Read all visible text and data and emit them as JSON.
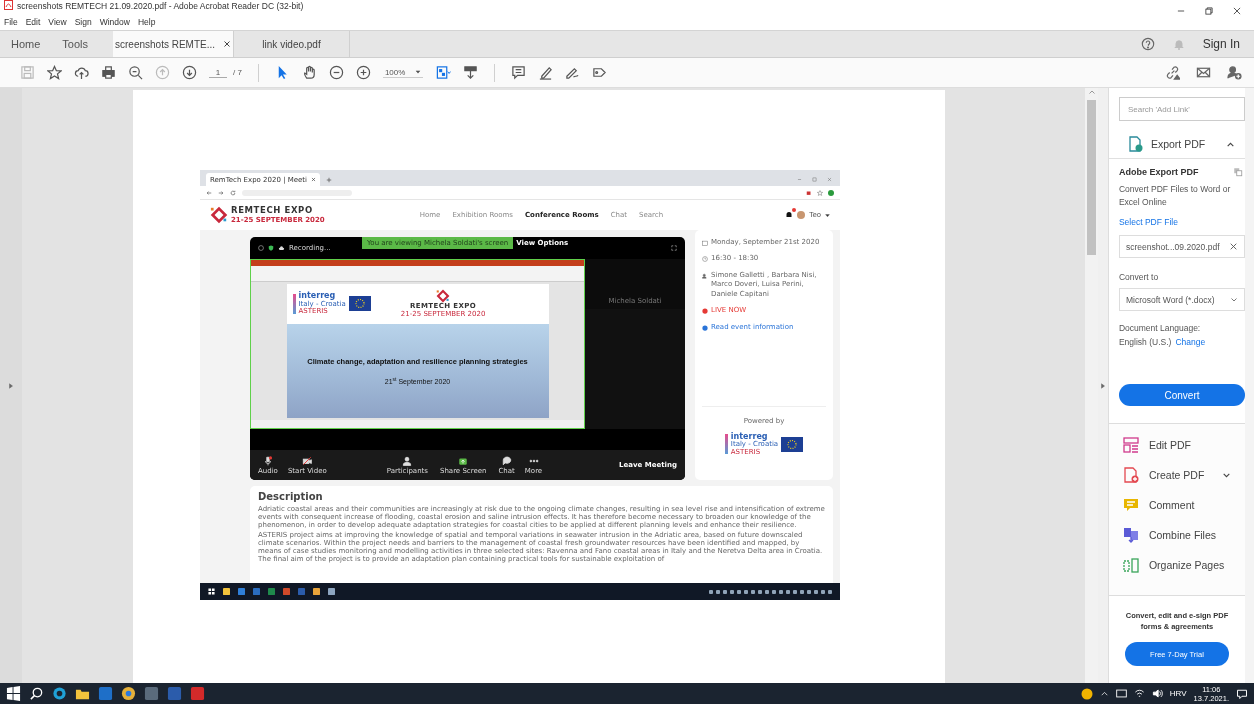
{
  "window": {
    "title": "screenshots REMTECH 21.09.2020.pdf - Adobe Acrobat Reader DC (32-bit)"
  },
  "menu": [
    "File",
    "Edit",
    "View",
    "Sign",
    "Window",
    "Help"
  ],
  "nav_tabs": [
    {
      "label": "Home",
      "selected": false
    },
    {
      "label": "Tools",
      "selected": false
    }
  ],
  "doc_tabs": [
    {
      "label": "screenshots REMTE...",
      "selected": true
    },
    {
      "label": "link video.pdf",
      "selected": false
    }
  ],
  "sign_in": "Sign In",
  "toolbar": {
    "nav_tools": [
      {
        "kind": "save",
        "disabled": true
      },
      {
        "kind": "star",
        "disabled": false
      },
      {
        "kind": "upload",
        "disabled": false
      },
      {
        "kind": "print",
        "disabled": false
      },
      {
        "kind": "find",
        "disabled": false
      },
      {
        "kind": "prev",
        "disabled": true
      },
      {
        "kind": "next",
        "disabled": false
      }
    ],
    "page": "1",
    "page_count": "/ 7",
    "view_tools": [
      {
        "kind": "select",
        "active": true
      },
      {
        "kind": "hand",
        "active": false
      },
      {
        "kind": "zoomout",
        "active": false
      },
      {
        "kind": "zoomin",
        "active": false
      }
    ],
    "zoom": "100%",
    "edit_tools": [
      {
        "kind": "comment"
      },
      {
        "kind": "highlight"
      },
      {
        "kind": "sign"
      },
      {
        "kind": "tag"
      }
    ]
  },
  "document": {
    "browser_tab": "RemTech Expo 2020 | Meeti",
    "site": {
      "logo_title": "REMTECH EXPO",
      "logo_dates": "21-25 SEPTEMBER 2020",
      "nav": [
        {
          "label": "Home",
          "selected": false
        },
        {
          "label": "Exhibition Rooms",
          "selected": false
        },
        {
          "label": "Conference Rooms",
          "selected": true
        },
        {
          "label": "Chat",
          "selected": false
        },
        {
          "label": "Search",
          "selected": false
        }
      ],
      "user": "Teo"
    },
    "meeting": {
      "recording": "Recording...",
      "banner": "You are viewing Michela Soldati's screen",
      "view_options": "View Options",
      "participant": "Michela Soldati",
      "controls": [
        {
          "label": "Audio",
          "kind": "audio"
        },
        {
          "label": "Start Video",
          "kind": "video"
        },
        {
          "label": "Participants",
          "kind": "participants"
        },
        {
          "label": "Share Screen",
          "kind": "share"
        },
        {
          "label": "Chat",
          "kind": "chat"
        },
        {
          "label": "More",
          "kind": "more"
        }
      ],
      "leave": "Leave Meeting"
    },
    "slide": {
      "partner": "interreg",
      "partner_sub": "Italy - Croatia",
      "project": "ASTERIS",
      "logo_title": "REMTECH EXPO",
      "logo_dates": "21-25 SEPTEMBER 2020",
      "title": "Climate change, adaptation and resilience planning strategies",
      "date": "21$^{st}$ September 2020"
    },
    "event": {
      "date": "Monday, September 21st 2020",
      "time": "16:30 - 18:30",
      "speakers": "Simone Galletti , Barbara Nisi, Marco Doveri, Luisa Perini, Daniele Capitani",
      "live": "LIVE NOW",
      "read_more": "Read event information",
      "powered_by": "Powered by",
      "partner": "interreg",
      "partner_sub": "Italy - Croatia",
      "project": "ASTERIS"
    },
    "description": {
      "heading": "Description",
      "paragraphs": [
        "Adriatic coastal areas and their communities are increasingly at risk due to the ongoing climate changes, resulting in sea level rise and intensification of extreme events with consequent increase of flooding, coastal erosion and saline intrusion effects. It has therefore become necessary to broaden our knowledge of the phenomenon, in order to develop adequate adaptation strategies for coastal cities to be applied at different planning levels and enhance their resilience.",
        "ASTERIS project aims at improving the knowledge of spatial and temporal variations in seawater intrusion in the Adriatic area, based on future downscaled climate scenarios. Within the project needs and barriers to the management of coastal fresh groundwater resources have been identified and mapped, by means of case studies monitoring and modelling activities in three selected sites: Ravenna and Fano coastal areas in Italy and the Neretva Delta area in Croatia. The final aim of the project is to provide an adaptation plan containing practical tools for sustainable exploitation of"
      ]
    }
  },
  "side_panel": {
    "search": {
      "placeholder": "Search 'Add Link'"
    },
    "export": {
      "label": "Export PDF",
      "expanded": true,
      "heading": "Adobe Export PDF",
      "text": "Convert PDF Files to Word or Excel Online",
      "select_link": "Select PDF File",
      "file": "screenshot...09.2020.pdf",
      "convert_label": "Convert to",
      "format": "Microsoft Word (*.docx)",
      "language_label": "Document Language:",
      "language": "English (U.S.)",
      "change": "Change",
      "button": "Convert"
    },
    "tools": [
      {
        "label": "Edit PDF",
        "kind": "edit",
        "expandable": false
      },
      {
        "label": "Create PDF",
        "kind": "create",
        "expandable": true
      },
      {
        "label": "Comment",
        "kind": "comment",
        "expandable": false
      },
      {
        "label": "Combine Files",
        "kind": "combine",
        "expandable": false
      },
      {
        "label": "Organize Pages",
        "kind": "organize",
        "expandable": false
      }
    ],
    "promo": {
      "text": "Convert, edit and e-sign PDF forms & agreements",
      "button": "Free 7-Day Trial"
    }
  },
  "taskbar": {
    "language": "HRV",
    "time": "11:06",
    "date": "13.7.2021."
  }
}
